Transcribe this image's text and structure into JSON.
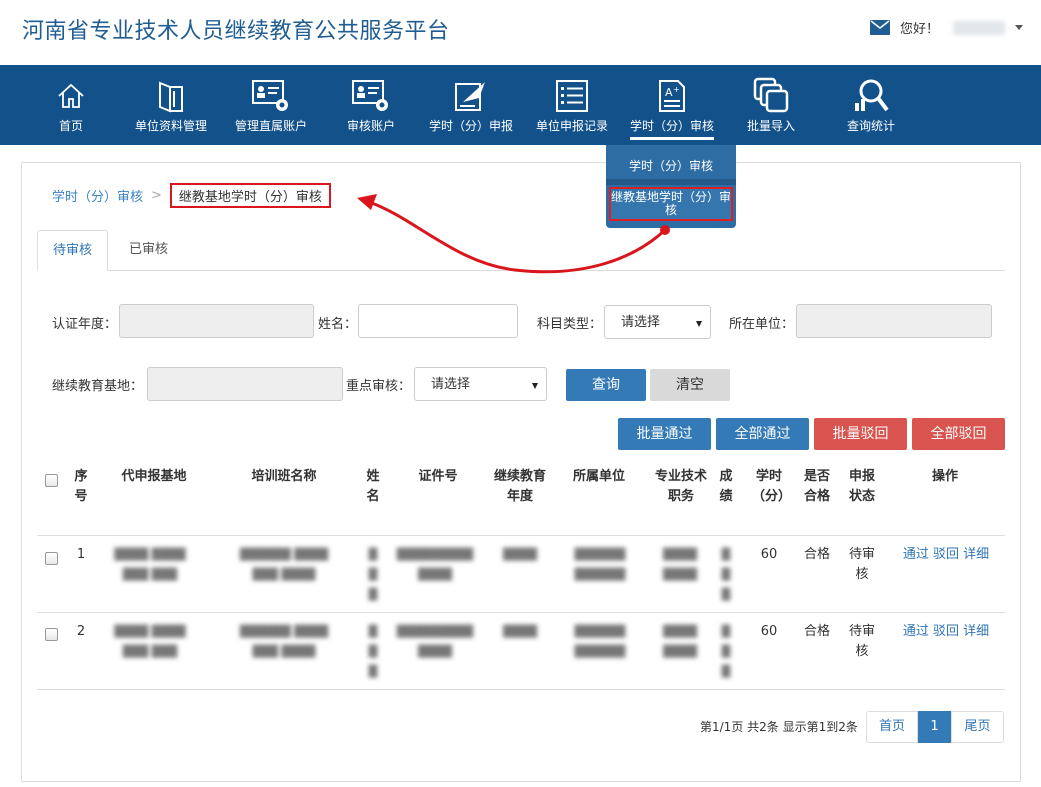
{
  "header": {
    "title": "河南省专业技术人员继续教育公共服务平台",
    "greeting": "您好！"
  },
  "nav": {
    "items": [
      {
        "label": "首页",
        "icon": "home-icon"
      },
      {
        "label": "单位资料管理",
        "icon": "book-icon"
      },
      {
        "label": "管理直属账户",
        "icon": "account-gear-icon"
      },
      {
        "label": "审核账户",
        "icon": "account-review-icon"
      },
      {
        "label": "学时（分）申报",
        "icon": "declare-icon"
      },
      {
        "label": "单位申报记录",
        "icon": "list-icon"
      },
      {
        "label": "学时（分）审核",
        "icon": "grade-icon"
      },
      {
        "label": "批量导入",
        "icon": "import-icon"
      },
      {
        "label": "查询统计",
        "icon": "search-stats-icon"
      }
    ],
    "active_index": 6
  },
  "dropdown": {
    "item1": "学时（分）审核",
    "item2": "继教基地学时（分）审核"
  },
  "breadcrumb": {
    "parent": "学时（分）审核",
    "current": "继教基地学时（分）审核"
  },
  "tabs": {
    "pending": "待审核",
    "done": "已审核"
  },
  "form": {
    "cert_year_label": "认证年度：",
    "name_label": "姓名：",
    "subject_type_label": "科目类型：",
    "subject_type_value": "请选择",
    "unit_label": "所在单位：",
    "base_label": "继续教育基地：",
    "key_review_label": "重点审核：",
    "key_review_value": "请选择",
    "query_button": "查询",
    "clear_button": "清空"
  },
  "actions": {
    "batch_pass": "批量通过",
    "all_pass": "全部通过",
    "batch_reject": "批量驳回",
    "all_reject": "全部驳回"
  },
  "table": {
    "headers": {
      "seq": "序号",
      "base": "代申报基地",
      "class": "培训班名称",
      "name": "姓名",
      "id": "证件号",
      "year": "继续教育年度",
      "unit": "所属单位",
      "title": "专业技术职务",
      "score": "成绩",
      "hours": "学时（分）",
      "qualified": "是否合格",
      "status": "申报状态",
      "ops": "操作"
    },
    "rows": [
      {
        "seq": "1",
        "hours": "60",
        "qualified": "合格",
        "status": "待审核"
      },
      {
        "seq": "2",
        "hours": "60",
        "qualified": "合格",
        "status": "待审核"
      }
    ],
    "op_pass": "通过",
    "op_reject": "驳回",
    "op_detail": "详细"
  },
  "pagination": {
    "info": "第1/1页 共2条 显示第1到2条",
    "first": "首页",
    "current": "1",
    "last": "尾页"
  }
}
